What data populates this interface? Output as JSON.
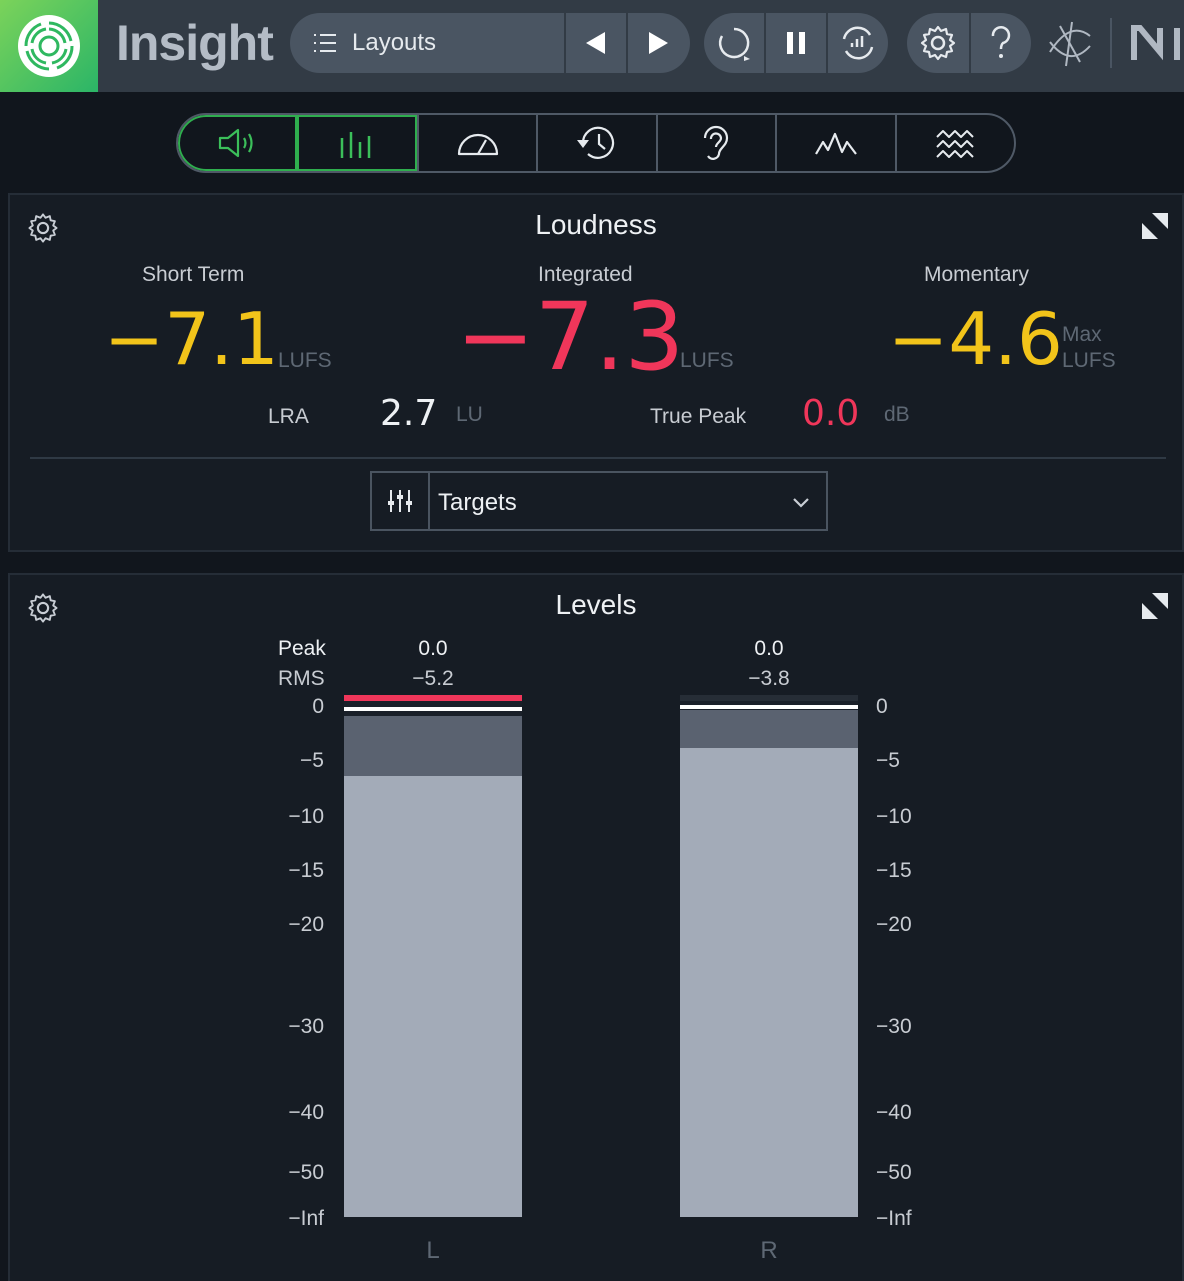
{
  "app": {
    "title": "Insight"
  },
  "toolbar": {
    "layouts_label": "Layouts",
    "icons": [
      "menu-icon",
      "previous-icon",
      "next-icon",
      "reset-icon",
      "pause-icon",
      "loop-icon",
      "settings-icon",
      "help-icon",
      "link-icon",
      "ni-logo"
    ]
  },
  "tabs": [
    {
      "icon": "speaker-icon",
      "active": true
    },
    {
      "icon": "meter-bars-icon",
      "active": true
    },
    {
      "icon": "gauge-icon",
      "active": false
    },
    {
      "icon": "history-icon",
      "active": false
    },
    {
      "icon": "ear-icon",
      "active": false
    },
    {
      "icon": "spectrum-icon",
      "active": false
    },
    {
      "icon": "spectrogram-icon",
      "active": false
    }
  ],
  "loudness": {
    "title": "Loudness",
    "short_term": {
      "label": "Short Term",
      "value": "−7.1",
      "unit": "LUFS"
    },
    "integrated": {
      "label": "Integrated",
      "value": "−7.3",
      "unit": "LUFS"
    },
    "momentary": {
      "label": "Momentary",
      "value": "−4.6",
      "unit_line1": "Max",
      "unit_line2": "LUFS"
    },
    "lra": {
      "label": "LRA",
      "value": "2.7",
      "unit": "LU"
    },
    "true_peak": {
      "label": "True Peak",
      "value": "0.0",
      "unit": "dB"
    },
    "targets_label": "Targets"
  },
  "levels": {
    "title": "Levels",
    "peak_label": "Peak",
    "rms_label": "RMS",
    "channels": [
      {
        "name": "L",
        "peak": "0.0",
        "rms": "−5.2",
        "clip": true
      },
      {
        "name": "R",
        "peak": "0.0",
        "rms": "−3.8",
        "clip": false
      }
    ],
    "scale": [
      "0",
      "−5",
      "−10",
      "−15",
      "−20",
      "−30",
      "−40",
      "−50",
      "−Inf"
    ]
  },
  "colors": {
    "accent_green": "#2fae4e",
    "short_term_yellow": "#f2c41a",
    "integrated_red": "#f0365a",
    "meter_fill": "#a3abb8"
  }
}
